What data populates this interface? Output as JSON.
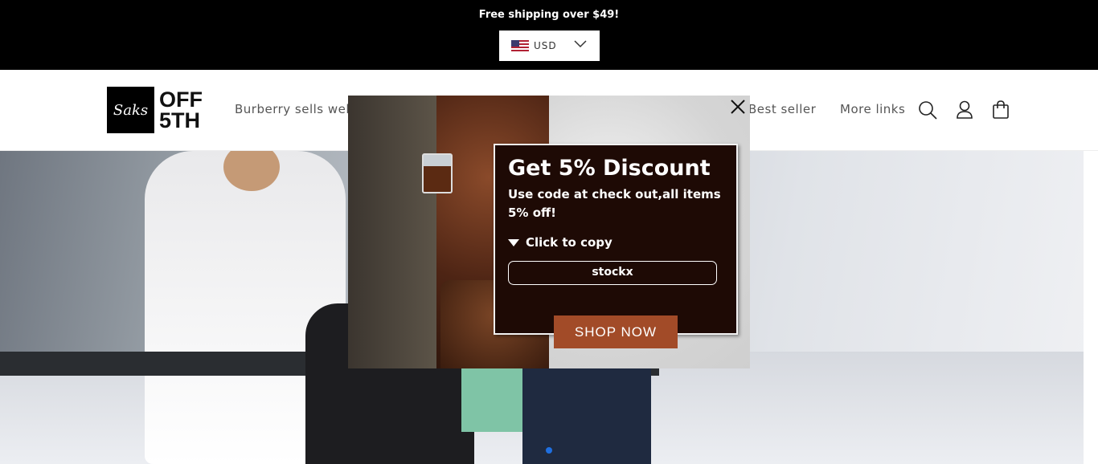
{
  "announcement": {
    "text": "Free shipping over $49!"
  },
  "currency": {
    "code": "USD"
  },
  "header": {
    "logo": {
      "script": "Saks",
      "wordmark_line1": "OFF",
      "wordmark_line2": "5TH"
    },
    "nav": [
      {
        "label": "Burberry sells wel"
      },
      {
        "label": "Best seller"
      },
      {
        "label": "More links"
      }
    ],
    "icons": [
      "search-icon",
      "account-icon",
      "cart-icon"
    ]
  },
  "popup": {
    "title": "Get 5% Discount",
    "description": "Use code at check out,all items 5% off!",
    "copy_label": "Click to copy",
    "code": "stockx",
    "cta": "SHOP NOW",
    "close_icon": "close-icon"
  },
  "hero": {
    "slide_count_visible": 1,
    "active_slide": 1
  },
  "colors": {
    "announcement_bg": "#000000",
    "popup_card_bg": "#1e0a05",
    "cta_bg": "#a24b28",
    "slide_dot": "#1f6fe0"
  }
}
